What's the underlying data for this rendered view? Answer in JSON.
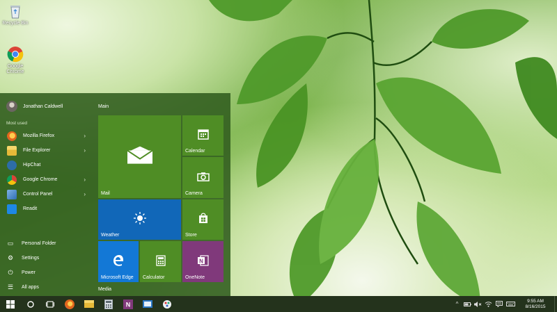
{
  "desktop": {
    "icons": [
      {
        "label": "Recycle Bin",
        "icon": "recycle-bin-icon"
      },
      {
        "label": "Google Chrome",
        "icon": "chrome-icon"
      }
    ]
  },
  "start_menu": {
    "user": {
      "name": "Jonathan Caldwell"
    },
    "most_used_label": "Most used",
    "apps": [
      {
        "label": "Mozilla Firefox",
        "icon": "firefox-icon",
        "color": "#e2661d",
        "has_submenu": true
      },
      {
        "label": "File Explorer",
        "icon": "folder-icon",
        "color": "#f2c94c",
        "has_submenu": true
      },
      {
        "label": "HipChat",
        "icon": "hipchat-icon",
        "color": "#2d6da8",
        "has_submenu": false
      },
      {
        "label": "Google Chrome",
        "icon": "chrome-icon",
        "color": "#3b9d47",
        "has_submenu": true
      },
      {
        "label": "Control Panel",
        "icon": "control-panel-icon",
        "color": "#4a86c8",
        "has_submenu": true
      },
      {
        "label": "Readit",
        "icon": "readit-icon",
        "color": "#1e88e5",
        "has_submenu": false
      }
    ],
    "submenu_chevron": "›",
    "system_items": [
      {
        "label": "Personal Folder",
        "icon": "folder-outline-icon",
        "glyph": "▭"
      },
      {
        "label": "Settings",
        "icon": "gear-icon",
        "glyph": "⚙"
      },
      {
        "label": "Power",
        "icon": "power-icon",
        "glyph": "⏻"
      },
      {
        "label": "All apps",
        "icon": "list-icon",
        "glyph": "☰"
      }
    ],
    "groups": {
      "main": "Main",
      "media": "Media"
    },
    "tiles": {
      "mail": {
        "label": "Mail",
        "icon": "mail-icon",
        "color": "#4f8d25"
      },
      "calendar": {
        "label": "Calendar",
        "icon": "calendar-icon",
        "color": "#4f8d25"
      },
      "camera": {
        "label": "Camera",
        "icon": "camera-icon",
        "color": "#4f8d25"
      },
      "weather": {
        "label": "Weather",
        "icon": "sun-icon",
        "color": "#1167b8"
      },
      "store": {
        "label": "Store",
        "icon": "store-icon",
        "color": "#4f8d25"
      },
      "edge": {
        "label": "Microsoft Edge",
        "icon": "edge-icon",
        "color": "#1378d6"
      },
      "calculator": {
        "label": "Calculator",
        "icon": "calculator-icon",
        "color": "#4f8d25"
      },
      "onenote": {
        "label": "OneNote",
        "icon": "onenote-icon",
        "color": "#80397b"
      }
    }
  },
  "taskbar": {
    "pinned": [
      "start-button",
      "cortana-button",
      "task-view-button",
      "firefox-icon",
      "file-explorer-icon",
      "calculator-icon",
      "onenote-icon",
      "mail-icon",
      "paint-icon"
    ],
    "tray_icons": [
      "show-hidden-icon",
      "battery-icon",
      "volume-mute-icon",
      "network-icon",
      "notifications-icon",
      "keyboard-icon"
    ],
    "tray_chevron": "^",
    "time": "9:55 AM",
    "date": "8/16/2015"
  }
}
